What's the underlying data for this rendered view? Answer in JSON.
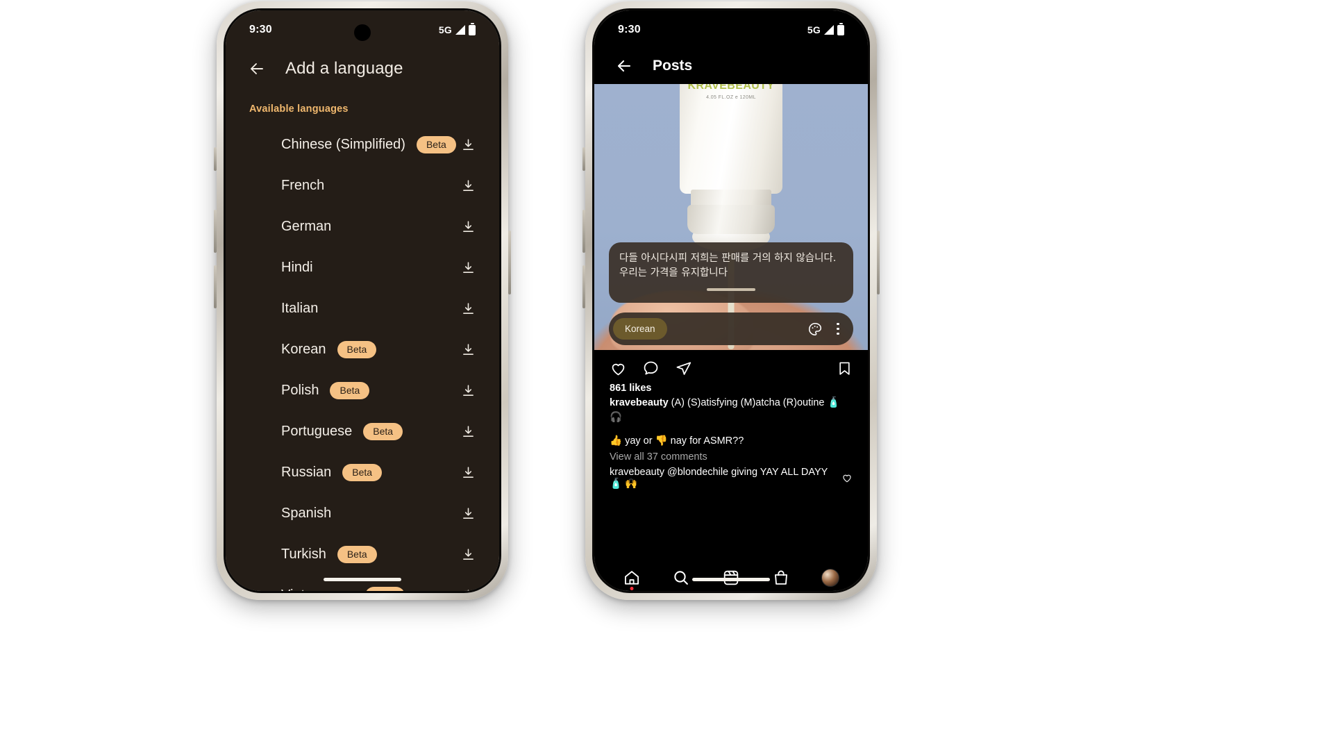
{
  "left_phone": {
    "status_bar": {
      "time": "9:30",
      "network": "5G",
      "signal_icon": "signal-triangle-icon",
      "battery_icon": "battery-icon"
    },
    "app_bar": {
      "back_icon": "back-arrow-icon",
      "title": "Add a language"
    },
    "section_label": "Available languages",
    "download_icon": "download-icon",
    "beta_label": "Beta",
    "languages": [
      {
        "name": "Chinese (Simplified)",
        "beta": true
      },
      {
        "name": "French",
        "beta": false
      },
      {
        "name": "German",
        "beta": false
      },
      {
        "name": "Hindi",
        "beta": false
      },
      {
        "name": "Italian",
        "beta": false
      },
      {
        "name": "Korean",
        "beta": true
      },
      {
        "name": "Polish",
        "beta": true
      },
      {
        "name": "Portuguese",
        "beta": true
      },
      {
        "name": "Russian",
        "beta": true
      },
      {
        "name": "Spanish",
        "beta": false
      },
      {
        "name": "Turkish",
        "beta": true
      },
      {
        "name": "Vietnamese",
        "beta": true
      }
    ]
  },
  "right_phone": {
    "status_bar": {
      "time": "9:30",
      "network": "5G",
      "signal_icon": "signal-triangle-icon",
      "battery_icon": "battery-icon"
    },
    "app_bar": {
      "back_icon": "back-arrow-icon",
      "title": "Posts"
    },
    "media": {
      "brand_text": "KRAVEBEAUTY",
      "volume_text": "4.05 FL.OZ  e  120ML",
      "alt": "white pump bottle dispensing cream held in hand against blue background"
    },
    "caption_overlay": {
      "text": "다들 아시다시피 저희는 판매를 거의 하지 않습니다. 우리는 가격을 유지합니다",
      "language_chip": "Korean",
      "palette_icon": "palette-icon",
      "more_icon": "three-dot-menu-icon"
    },
    "post_actions": {
      "like_icon": "heart-icon",
      "comment_icon": "comment-bubble-icon",
      "share_icon": "share-paper-plane-icon",
      "save_icon": "bookmark-icon"
    },
    "post": {
      "likes": "861 likes",
      "caption_user": "kravebeauty",
      "caption_text": " (A) (S)atisfying (M)atcha (R)outine 🧴 🎧",
      "caption_line2": "👍 yay or 👎 nay for ASMR??",
      "view_comments": "View all 37 comments",
      "comment_user": "kravebeauty",
      "comment_text": " @blondechile giving YAY ALL DAYY 🧴 🙌",
      "comment_like_icon": "heart-outline-icon"
    },
    "bottom_nav": [
      {
        "name": "home",
        "icon": "home-icon",
        "badge": true
      },
      {
        "name": "search",
        "icon": "search-icon",
        "badge": false
      },
      {
        "name": "reels",
        "icon": "reels-icon",
        "badge": false
      },
      {
        "name": "shop",
        "icon": "shopping-bag-icon",
        "badge": false
      },
      {
        "name": "profile",
        "icon": "profile-avatar",
        "badge": false
      }
    ]
  },
  "colors": {
    "left_bg": "#241d17",
    "accent_orange": "#f0b86e",
    "beta_pill": "#f5c184",
    "ig_bg": "#000000",
    "media_blue": "#9fb1cf",
    "chip_olive": "#6c5a2c"
  }
}
